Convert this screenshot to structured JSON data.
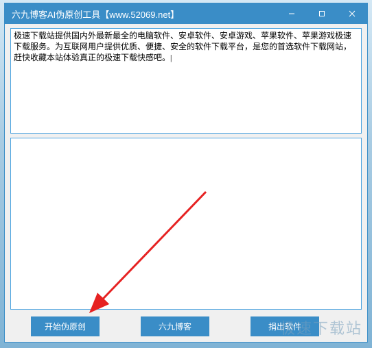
{
  "window": {
    "title": "六九博客AI伪原创工具【www.52069.net】"
  },
  "inputTop": {
    "value": "极速下载站提供国内外最新最全的电脑软件、安卓软件、安卓游戏、苹果软件、苹果游戏极速下载服务。为互联网用户提供优质、便捷、安全的软件下载平台，是您的首选软件下载网站，赶快收藏本站体验真正的极速下载快感吧。|"
  },
  "inputBottom": {
    "value": ""
  },
  "buttons": {
    "start": "开始伪原创",
    "blog": "六九博客",
    "donate": "捐出软件"
  },
  "watermark": "极速下载站"
}
